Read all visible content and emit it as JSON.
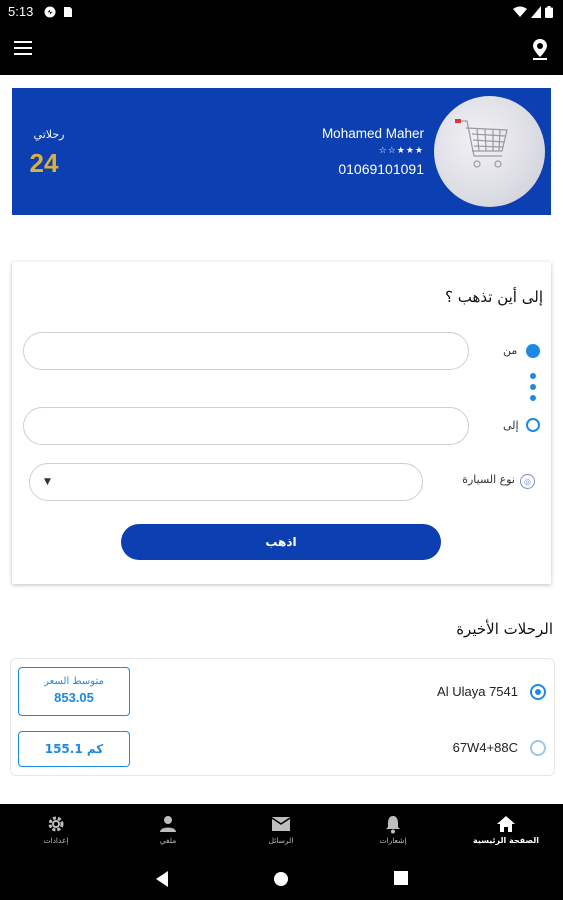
{
  "status_bar": {
    "time": "5:13"
  },
  "profile": {
    "name": "Mohamed Maher",
    "rating_stars": "☆☆★★★",
    "phone": "01069101091",
    "trips_label": "رحلاتي",
    "trips_count": "24"
  },
  "booking": {
    "title": "إلى أين تذهب ؟",
    "from_label": "من",
    "from_value": "",
    "to_label": "إلى",
    "to_value": "",
    "car_type_label": "نوع السيارة",
    "car_type_value": "",
    "go_button": "اذهب"
  },
  "recent": {
    "title": "الرحلات الأخيرة",
    "items": [
      {
        "label": "Al Ulaya 7541",
        "selected": true
      },
      {
        "label": "67W4+88C",
        "selected": false
      }
    ],
    "avg_price_label": "متوسط السعر",
    "avg_price_value": "853.05",
    "distance": "155.1 كم"
  },
  "bottom_nav": {
    "items": [
      {
        "label": "إعدادات",
        "icon": "gear-icon"
      },
      {
        "label": "ملفي",
        "icon": "person-icon"
      },
      {
        "label": "الرسائل",
        "icon": "mail-icon"
      },
      {
        "label": "إشعارات",
        "icon": "bell-icon"
      },
      {
        "label": "الصفحة الرئيسية",
        "icon": "home-icon",
        "active": true
      }
    ]
  },
  "colors": {
    "primary": "#0b3fb2",
    "accent": "#1e88e5",
    "gold": "#d9b23d"
  }
}
